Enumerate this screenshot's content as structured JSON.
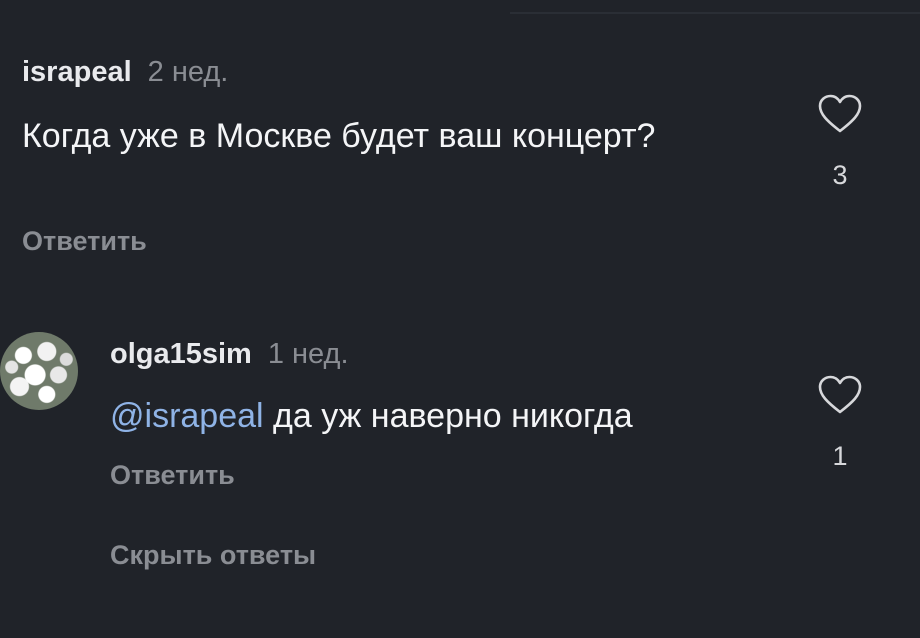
{
  "comments": [
    {
      "username": "israpeal",
      "time": "2 нед.",
      "text": "Когда уже в Москве будет ваш концерт?",
      "reply_label": "Ответить",
      "like_icon": "heart-outline-icon",
      "like_count": "3"
    },
    {
      "username": "olga15sim",
      "time": "1 нед.",
      "mention": "@israpeal",
      "text": " да уж наверно никогда",
      "reply_label": "Ответить",
      "like_icon": "heart-outline-icon",
      "like_count": "1",
      "avatar": "avatar-white-flowers"
    }
  ],
  "hide_replies_label": "Скрыть ответы",
  "colors": {
    "background": "#202329",
    "primary_text": "#f4f5f7",
    "secondary_text": "#8a8d93",
    "mention": "#8fb3e6"
  }
}
